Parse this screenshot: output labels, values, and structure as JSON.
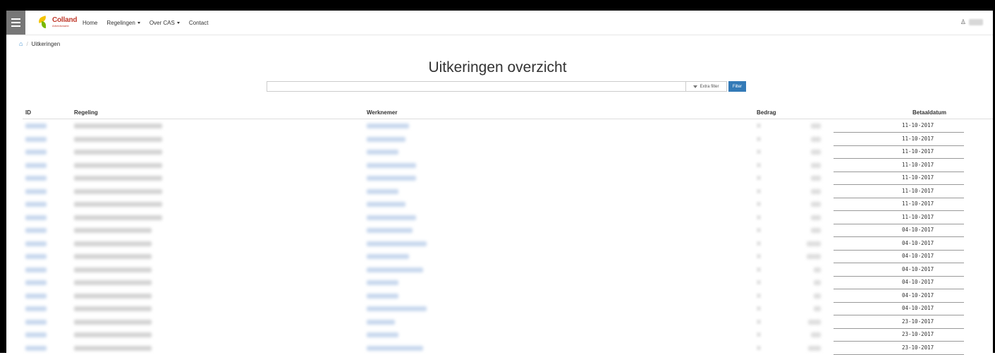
{
  "nav": {
    "logo_brand": "Colland",
    "logo_sub": "Arbeidsmarkt",
    "items": [
      {
        "label": "Home",
        "dropdown": false
      },
      {
        "label": "Regelingen",
        "dropdown": true
      },
      {
        "label": "Over CAS",
        "dropdown": true
      },
      {
        "label": "Contact",
        "dropdown": false
      }
    ],
    "user_icon": "user-icon"
  },
  "breadcrumb": {
    "home_icon": "home-icon",
    "separator": "/",
    "current": "Uitkeringen"
  },
  "page": {
    "title": "Uitkeringen overzicht"
  },
  "search": {
    "value": "",
    "placeholder": "",
    "extra_filter_label": "Extra filter",
    "filter_button_label": "Filter"
  },
  "table": {
    "columns": [
      "ID",
      "Regeling",
      "Werknemer",
      "Bedrag",
      "Betaaldatum"
    ],
    "rows": [
      {
        "betaaldatum": "11-10-2017",
        "id_len": 30,
        "reg_len": 125,
        "wn_len": 60,
        "amt_len": 14
      },
      {
        "betaaldatum": "11-10-2017",
        "id_len": 30,
        "reg_len": 125,
        "wn_len": 55,
        "amt_len": 14
      },
      {
        "betaaldatum": "11-10-2017",
        "id_len": 30,
        "reg_len": 125,
        "wn_len": 45,
        "amt_len": 14
      },
      {
        "betaaldatum": "11-10-2017",
        "id_len": 30,
        "reg_len": 125,
        "wn_len": 70,
        "amt_len": 14
      },
      {
        "betaaldatum": "11-10-2017",
        "id_len": 30,
        "reg_len": 125,
        "wn_len": 70,
        "amt_len": 14
      },
      {
        "betaaldatum": "11-10-2017",
        "id_len": 30,
        "reg_len": 125,
        "wn_len": 45,
        "amt_len": 14
      },
      {
        "betaaldatum": "11-10-2017",
        "id_len": 30,
        "reg_len": 125,
        "wn_len": 55,
        "amt_len": 14
      },
      {
        "betaaldatum": "11-10-2017",
        "id_len": 30,
        "reg_len": 125,
        "wn_len": 70,
        "amt_len": 14
      },
      {
        "betaaldatum": "04-10-2017",
        "id_len": 30,
        "reg_len": 110,
        "wn_len": 65,
        "amt_len": 14
      },
      {
        "betaaldatum": "04-10-2017",
        "id_len": 30,
        "reg_len": 110,
        "wn_len": 85,
        "amt_len": 20
      },
      {
        "betaaldatum": "04-10-2017",
        "id_len": 30,
        "reg_len": 110,
        "wn_len": 60,
        "amt_len": 20
      },
      {
        "betaaldatum": "04-10-2017",
        "id_len": 30,
        "reg_len": 110,
        "wn_len": 80,
        "amt_len": 10
      },
      {
        "betaaldatum": "04-10-2017",
        "id_len": 30,
        "reg_len": 110,
        "wn_len": 45,
        "amt_len": 10
      },
      {
        "betaaldatum": "04-10-2017",
        "id_len": 30,
        "reg_len": 110,
        "wn_len": 45,
        "amt_len": 10
      },
      {
        "betaaldatum": "04-10-2017",
        "id_len": 30,
        "reg_len": 110,
        "wn_len": 85,
        "amt_len": 10
      },
      {
        "betaaldatum": "23-10-2017",
        "id_len": 30,
        "reg_len": 110,
        "wn_len": 40,
        "amt_len": 18
      },
      {
        "betaaldatum": "23-10-2017",
        "id_len": 30,
        "reg_len": 110,
        "wn_len": 45,
        "amt_len": 14
      },
      {
        "betaaldatum": "23-10-2017",
        "id_len": 30,
        "reg_len": 110,
        "wn_len": 80,
        "amt_len": 18
      }
    ]
  },
  "colors": {
    "accent": "#337ab7",
    "link_blur": "#c8d8ee",
    "burger_bg": "#777777",
    "brand_red": "#c0392b"
  }
}
